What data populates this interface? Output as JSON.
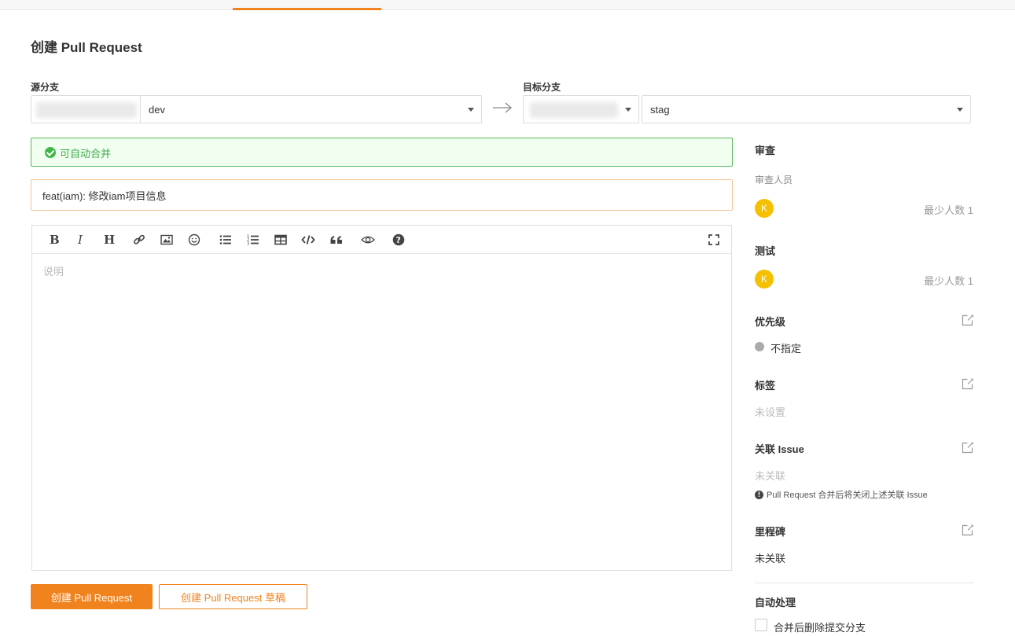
{
  "page": {
    "title": "创建 Pull Request"
  },
  "source": {
    "label": "源分支",
    "branch": "dev"
  },
  "target": {
    "label": "目标分支",
    "branch": "stag"
  },
  "merge_status": {
    "text": "可自动合并"
  },
  "pr_title": {
    "value": "feat(iam): 修改iam项目信息"
  },
  "editor": {
    "placeholder": "说明",
    "toolbar": [
      "bold-icon",
      "italic-icon",
      "heading-icon",
      "link-icon",
      "image-icon",
      "emoji-icon",
      "unordered-list-icon",
      "ordered-list-icon",
      "table-icon",
      "code-icon",
      "quote-icon",
      "preview-icon",
      "help-icon",
      "fullscreen-icon"
    ]
  },
  "buttons": {
    "create": "创建 Pull Request",
    "create_draft": "创建 Pull Request 草稿"
  },
  "sidebar": {
    "review": {
      "title": "审查",
      "sub": "审查人员",
      "avatar": "K",
      "min": "最少人数 1"
    },
    "test": {
      "title": "测试",
      "avatar": "K",
      "min": "最少人数 1"
    },
    "priority": {
      "title": "优先级",
      "value": "不指定"
    },
    "labels": {
      "title": "标签",
      "value": "未设置"
    },
    "issue": {
      "title": "关联 Issue",
      "value": "未关联",
      "note": "Pull Request 合并后将关闭上述关联 Issue"
    },
    "milestone": {
      "title": "里程碑",
      "value": "未关联"
    },
    "auto": {
      "title": "自动处理",
      "option": "合并后删除提交分支"
    }
  },
  "colors": {
    "accent": "#f0831e",
    "success": "#3fb84b",
    "avatar": "#f5c000"
  }
}
